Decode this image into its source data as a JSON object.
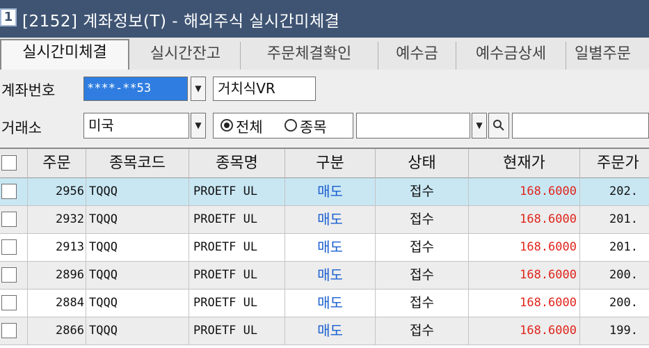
{
  "window": {
    "number": "1",
    "title": "[2152] 계좌정보(T) - 해외주식 실시간미체결"
  },
  "tabs": [
    {
      "label": "실시간미체결"
    },
    {
      "label": "실시간잔고"
    },
    {
      "label": "주문체결확인"
    },
    {
      "label": "예수금"
    },
    {
      "label": "예수금상세"
    },
    {
      "label": "일별주문"
    }
  ],
  "filters": {
    "account_label": "계좌번호",
    "account_value": "****-**53",
    "account_name": "거치식VR",
    "exchange_label": "거래소",
    "exchange_value": "미국",
    "radio_all": "전체",
    "radio_stock": "종목",
    "stock_value": ""
  },
  "table": {
    "headers": [
      "주문",
      "종목코드",
      "종목명",
      "구분",
      "상태",
      "현재가",
      "주문가"
    ],
    "rows": [
      {
        "order": "2956",
        "code": "TQQQ",
        "name": "PROETF UL",
        "side": "매도",
        "status": "접수",
        "current": "168.6000",
        "order_price": "202.",
        "selected": true
      },
      {
        "order": "2932",
        "code": "TQQQ",
        "name": "PROETF UL",
        "side": "매도",
        "status": "접수",
        "current": "168.6000",
        "order_price": "201.",
        "selected": false
      },
      {
        "order": "2913",
        "code": "TQQQ",
        "name": "PROETF UL",
        "side": "매도",
        "status": "접수",
        "current": "168.6000",
        "order_price": "201.",
        "selected": false
      },
      {
        "order": "2896",
        "code": "TQQQ",
        "name": "PROETF UL",
        "side": "매도",
        "status": "접수",
        "current": "168.6000",
        "order_price": "200.",
        "selected": false
      },
      {
        "order": "2884",
        "code": "TQQQ",
        "name": "PROETF UL",
        "side": "매도",
        "status": "접수",
        "current": "168.6000",
        "order_price": "200.",
        "selected": false
      },
      {
        "order": "2866",
        "code": "TQQQ",
        "name": "PROETF UL",
        "side": "매도",
        "status": "접수",
        "current": "168.6000",
        "order_price": "199.",
        "selected": false
      }
    ]
  },
  "colors": {
    "titlebar": "#3f5473",
    "selected_row": "#c9e7f3",
    "sell_text": "#1a5fd0",
    "price_text": "#e0241b",
    "account_highlight": "#2f7de0"
  },
  "icons": {
    "dropdown": "chevron-down-icon",
    "search": "magnifier-icon"
  }
}
